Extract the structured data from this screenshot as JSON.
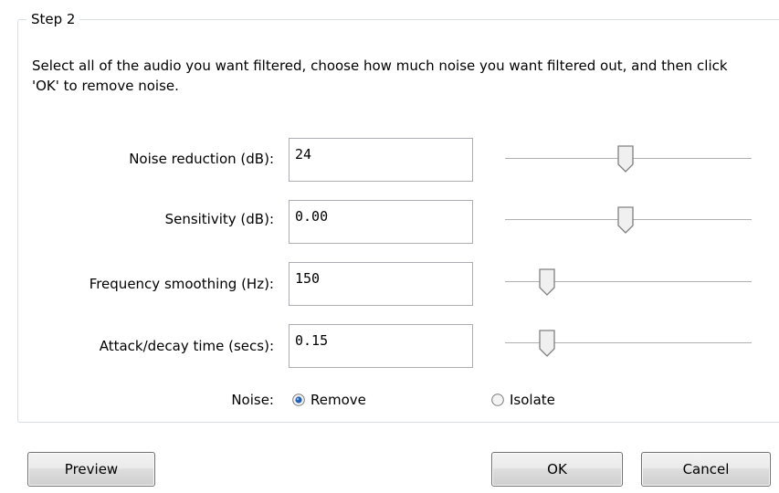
{
  "step": {
    "title": "Step 2",
    "instructions": "Select all of the audio you want filtered, choose how much noise you want filtered out, and then click 'OK' to remove noise."
  },
  "params": {
    "noise_reduction": {
      "label": "Noise reduction (dB):",
      "value": "24",
      "slider_fraction": 0.49
    },
    "sensitivity": {
      "label": "Sensitivity (dB):",
      "value": "0.00",
      "slider_fraction": 0.49
    },
    "frequency_smoothing": {
      "label": "Frequency smoothing (Hz):",
      "value": "150",
      "slider_fraction": 0.17
    },
    "attack_decay": {
      "label": "Attack/decay time (secs):",
      "value": "0.15",
      "slider_fraction": 0.17
    }
  },
  "noise": {
    "label": "Noise:",
    "options": [
      "Remove",
      "Isolate"
    ],
    "selected": "Remove"
  },
  "buttons": {
    "preview": "Preview",
    "ok": "OK",
    "cancel": "Cancel"
  },
  "colors": {
    "groupbox_border": "#d5dfe5",
    "textbox_border": "#abadb3",
    "radio_selected": "#1f5fb4"
  }
}
